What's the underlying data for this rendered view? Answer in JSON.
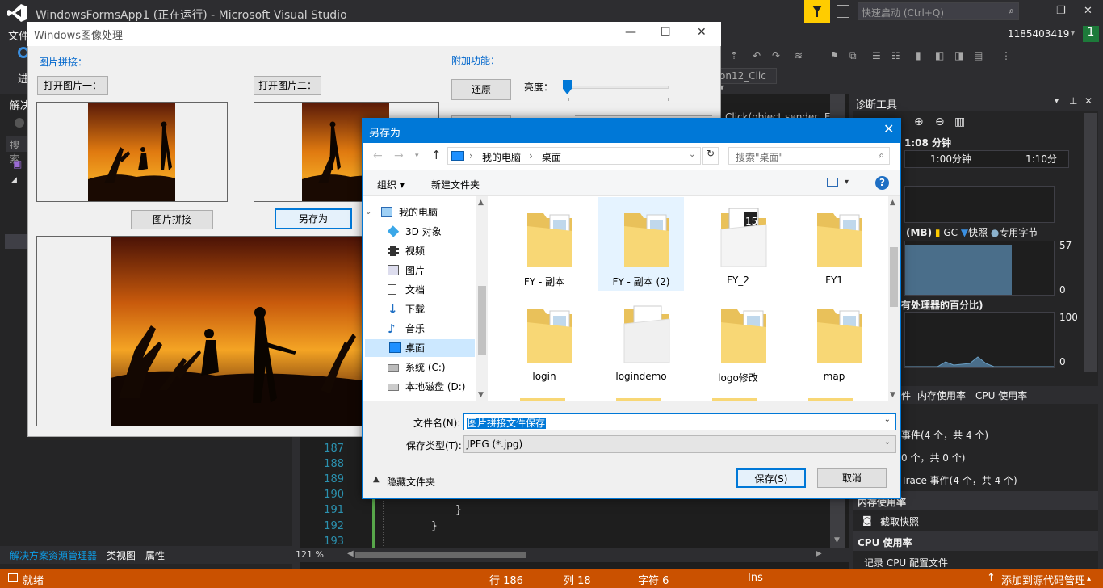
{
  "vs": {
    "title": "WindowsFormsApp1 (正在运行) - Microsoft Visual Studio",
    "quick_launch_placeholder": "快速启动 (Ctrl+Q)",
    "menu_first": "文件",
    "toolbar_first": "进",
    "user": "1185403419",
    "badge": "1",
    "combo_value": "on12_Clic",
    "left_panel_header": "解决",
    "left_search": "搜索",
    "left_tabs": [
      "解决方案资源管理器",
      "类视图",
      "属性"
    ],
    "editor_partial_header": "Click(object sender, E",
    "line_numbers": [
      "187",
      "188",
      "189",
      "190",
      "191",
      "192",
      "193"
    ],
    "code_lines": [
      "}",
      "}"
    ],
    "zoom": "121 %",
    "diag": {
      "title": "诊断工具",
      "session": "1:08 分钟",
      "timeline": [
        "1:00分钟",
        "1:10分"
      ],
      "memory_legend": "(MB)",
      "legend_gc": "GC",
      "legend_snapshot": "快照",
      "legend_private": "专用字节",
      "mem_max": "57",
      "mem_min": "0",
      "cpu_label": "有处理器的百分比)",
      "cpu_max": "100",
      "cpu_min": "0",
      "tabs": [
        "件",
        "内存使用率",
        "CPU 使用率"
      ],
      "events": [
        "事件(4 个，共 4 个)",
        "0 个，共 0 个)",
        "Trace 事件(4 个，共 4 个)"
      ],
      "mem_section": "内存使用率",
      "snapshot_btn": "截取快照",
      "cpu_section": "CPU 使用率",
      "cpu_record": "记录 CPU 配置文件"
    },
    "status": {
      "ready": "就绪",
      "row": "行 186",
      "col": "列 18",
      "char": "字符 6",
      "ins": "Ins",
      "source": "添加到源代码管理"
    }
  },
  "form": {
    "title": "Windows图像处理",
    "section_stitch": "图片拼接：",
    "open1": "打开图片一：",
    "open2": "打开图片二：",
    "stitch_btn": "图片拼接",
    "saveas_btn": "另存为",
    "section_extra": "附加功能：",
    "restore_btn": "还原",
    "brightness_label": "亮度：",
    "brightness_level_pct": 2
  },
  "dialog": {
    "title": "另存为",
    "breadcrumb": [
      "我的电脑",
      "桌面"
    ],
    "search_placeholder": "搜索\"桌面\"",
    "organize": "组织",
    "new_folder": "新建文件夹",
    "nav_items": [
      {
        "label": "我的电脑",
        "icon": "computer-icon"
      },
      {
        "label": "3D 对象",
        "icon": "cube-icon"
      },
      {
        "label": "视频",
        "icon": "video-icon"
      },
      {
        "label": "图片",
        "icon": "pictures-icon"
      },
      {
        "label": "文档",
        "icon": "document-icon"
      },
      {
        "label": "下载",
        "icon": "download-icon"
      },
      {
        "label": "音乐",
        "icon": "music-icon"
      },
      {
        "label": "桌面",
        "icon": "desktop-icon"
      },
      {
        "label": "系统 (C:)",
        "icon": "drive-icon"
      },
      {
        "label": "本地磁盘 (D:)",
        "icon": "drive-icon"
      }
    ],
    "files": [
      {
        "name": "FY - 副本",
        "type": "folder"
      },
      {
        "name": "FY - 副本 (2)",
        "type": "folder",
        "selected": true
      },
      {
        "name": "FY_2",
        "type": "folder-doc"
      },
      {
        "name": "FY1",
        "type": "folder"
      },
      {
        "name": "login",
        "type": "folder"
      },
      {
        "name": "logindemo",
        "type": "folder-empty"
      },
      {
        "name": "logo修改",
        "type": "folder"
      },
      {
        "name": "map",
        "type": "folder"
      }
    ],
    "filename_label": "文件名(N):",
    "filename_value": "图片拼接文件保存",
    "filetype_label": "保存类型(T):",
    "filetype_value": "JPEG (*.jpg)",
    "hide_folders": "隐藏文件夹",
    "save_btn": "保存(S)",
    "cancel_btn": "取消"
  },
  "colors": {
    "vs_bg": "#2d2d30",
    "status_orange": "#ca5100",
    "dialog_blue": "#0078d7",
    "folder_yellow": "#f8d775"
  }
}
